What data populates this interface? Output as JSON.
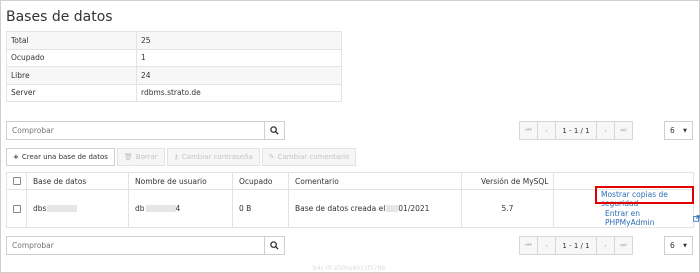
{
  "page": {
    "title": "Bases de datos"
  },
  "summary": [
    {
      "label": "Total",
      "value": "25"
    },
    {
      "label": "Ocupado",
      "value": "1"
    },
    {
      "label": "Libre",
      "value": "24"
    },
    {
      "label": "Server",
      "value": "rdbms.strato.de"
    }
  ],
  "search_top": {
    "placeholder": "Comprobar"
  },
  "search_bottom": {
    "placeholder": "Comprobar"
  },
  "pagination": {
    "page_label": "1 - 1 / 1",
    "page_size": "6"
  },
  "toolbar": {
    "create_label": "Crear una base de datos",
    "delete_label": "Borrar",
    "password_label": "Cambiar contraseña",
    "comment_label": "Cambiar comentario"
  },
  "table": {
    "columns": [
      "Base de datos",
      "Nombre de usuario",
      "Ocupado",
      "Comentario",
      "Versión de MySQL"
    ],
    "rows": [
      {
        "database": "dbs",
        "username": "db",
        "username_suffix": "4",
        "used": "0 B",
        "comment_prefix": "Base de datos creada el ",
        "comment_suffix": "01/2021",
        "mysql_version": "5.7",
        "backup_link": "Mostrar copias de seguridad",
        "phpmyadmin_link": "Entrar en PHPMyAdmin"
      }
    ]
  },
  "footer": {
    "text": "b4c 0f a50be8913f5788"
  },
  "colors": {
    "highlight": "#e00000",
    "link": "#2a6db5"
  }
}
